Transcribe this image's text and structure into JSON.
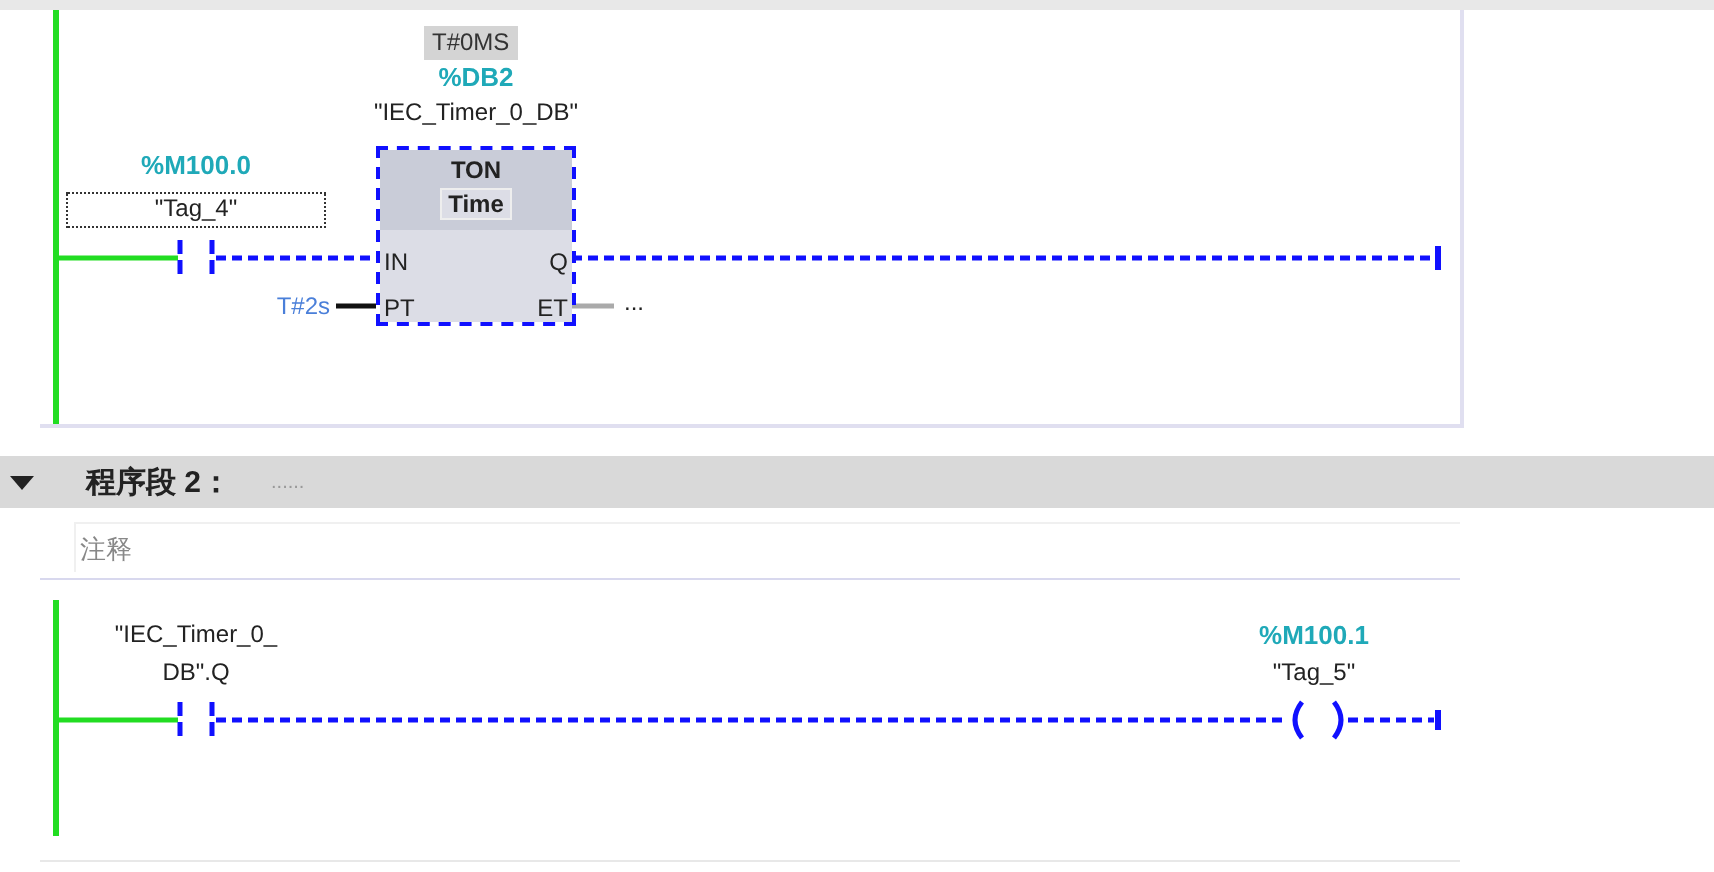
{
  "network_1": {
    "contact": {
      "address": "%M100.0",
      "tag": "\"Tag_4\"",
      "selected": true,
      "power_flow": false
    },
    "timer": {
      "preset_display": "T#0MS",
      "db_address": "%DB2",
      "db_name": "\"IEC_Timer_0_DB\"",
      "type": "TON",
      "data_type": "Time",
      "power_flow": false,
      "pins": [
        {
          "label": "IN"
        },
        {
          "label": "Q"
        },
        {
          "label": "PT"
        },
        {
          "label": "ET"
        }
      ],
      "pt_value": "T#2s",
      "et_value": "..."
    }
  },
  "network_2": {
    "expanded": true,
    "title": "程序段 2：",
    "title_dots": "......",
    "comment_placeholder": "注释",
    "contact": {
      "operand": "\"IEC_Timer_0_\nDB\".Q",
      "selected": false,
      "power_flow": false
    },
    "coil": {
      "address": "%M100.1",
      "tag": "\"Tag_5\"",
      "power_flow": false
    }
  }
}
